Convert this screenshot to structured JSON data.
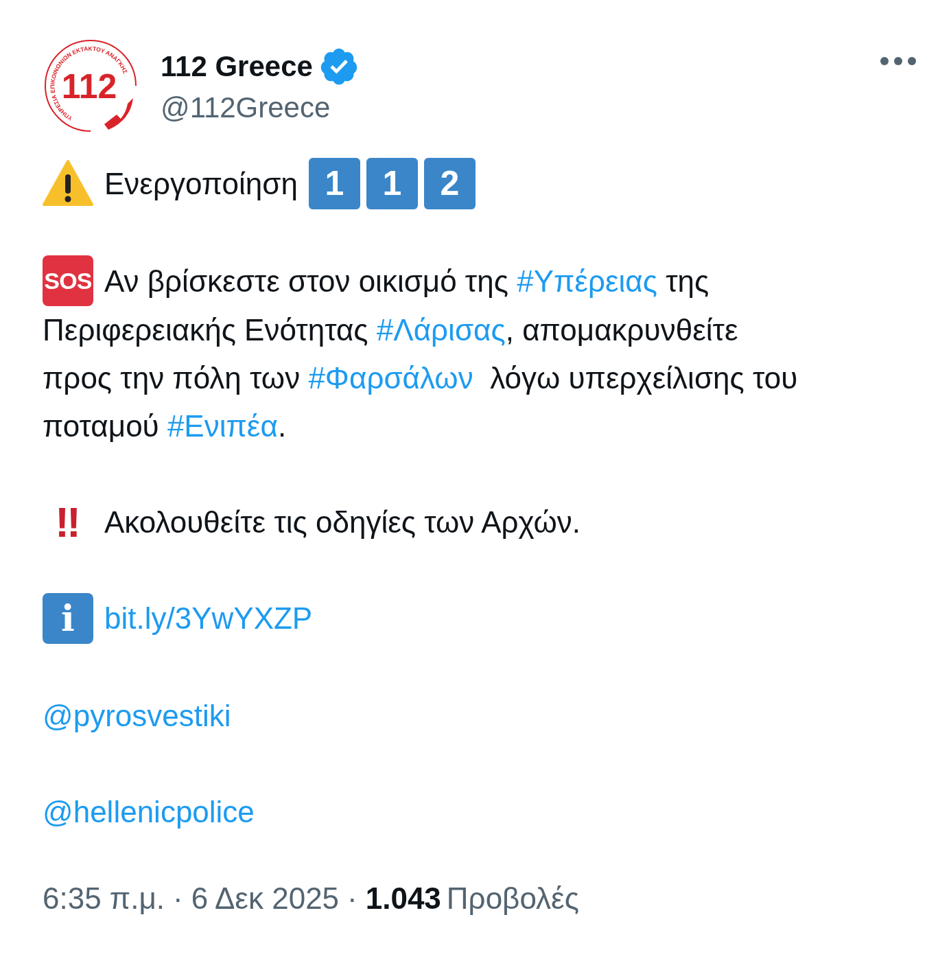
{
  "account": {
    "name": "112 Greece",
    "handle": "@112Greece",
    "verified": true,
    "logo": {
      "center": "112",
      "ring": "ΥΠΗΡΕΣΙΑ ΕΠΙΚΟΙΝΩΝΙΩΝ ΕΚΤΑΚΤΟΥ ΑΝΑΓΚΗΣ"
    }
  },
  "paragraphs": [
    {
      "kind": "warning",
      "lines": [
        [
          {
            "text": "Ενεργοποίηση",
            "link": false
          }
        ]
      ],
      "keycaps": [
        "1",
        "1",
        "2"
      ]
    },
    {
      "kind": "sos",
      "badge": "SOS",
      "lines": [
        [
          {
            "text": "Αν βρίσκεστε στον οικισμό της ",
            "link": false
          },
          {
            "text": "#Υπέρειας",
            "link": true
          },
          {
            "text": " της",
            "link": false
          }
        ],
        [
          {
            "text": "Περιφερειακής Ενότητας ",
            "link": false
          },
          {
            "text": "#Λάρισας",
            "link": true
          },
          {
            "text": ", απομακρυνθείτε",
            "link": false
          }
        ],
        [
          {
            "text": "προς την πόλη των ",
            "link": false
          },
          {
            "text": "#Φαρσάλων",
            "link": true
          },
          {
            "text": "  λόγω υπερχείλισης του",
            "link": false
          }
        ],
        [
          {
            "text": "ποταμού ",
            "link": false
          },
          {
            "text": "#Ενιπέα",
            "link": true
          },
          {
            "text": ".",
            "link": false
          }
        ]
      ]
    },
    {
      "kind": "bangbang",
      "badge": "‼",
      "lines": [
        [
          {
            "text": "Ακολουθείτε τις οδηγίες των Αρχών.",
            "link": false
          }
        ]
      ]
    },
    {
      "kind": "info",
      "badge": "i",
      "lines": [
        [
          {
            "text": "bit.ly/3YwYXZP",
            "link": true
          }
        ]
      ]
    },
    {
      "kind": "plain",
      "lines": [
        [
          {
            "text": "@pyrosvestiki",
            "link": true
          }
        ]
      ]
    },
    {
      "kind": "plain",
      "lines": [
        [
          {
            "text": "@hellenicpolice",
            "link": true
          }
        ]
      ]
    }
  ],
  "footer": {
    "time": "6:35 π.μ.",
    "separator_1": "·",
    "date": "6 Δεκ 2025",
    "separator_2": "·",
    "views_count": "1.043",
    "views_label": "Προβολές"
  }
}
